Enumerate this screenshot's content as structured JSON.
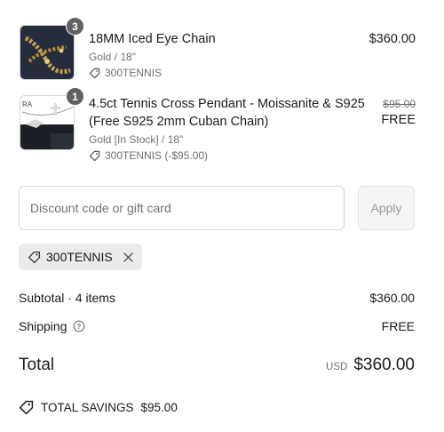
{
  "line_items": [
    {
      "title": "18MM Iced Eye Chain",
      "quantity": "3",
      "variant": "Gold / 18\"",
      "discount_code": "300TENNIS",
      "price": "$360.00",
      "image": "gold-iced-chain-thumbnail"
    },
    {
      "title_line1": "4.5ct Tennis Cross Pendant - Moissanite & S925",
      "title_line2": "(Free S925 2mm Cuban Chain)",
      "quantity": "1",
      "variant": "Gold [In Stock] / 18\"",
      "discount_code": "300TENNIS (-$95.00)",
      "original_price": "$95.00",
      "price": "FREE",
      "image": "cross-pendant-thumbnail"
    }
  ],
  "discount": {
    "placeholder": "Discount code or gift card",
    "apply_label": "Apply",
    "applied_code": "300TENNIS"
  },
  "summary": {
    "subtotal_label": "Subtotal · 4 items",
    "subtotal_value": "$360.00",
    "shipping_label": "Shipping",
    "shipping_value": "FREE",
    "total_label": "Total",
    "currency": "USD",
    "total_value": "$360.00",
    "savings_label": "TOTAL SAVINGS",
    "savings_value": "$95.00"
  },
  "colors": {
    "badge": "#616161",
    "muted_text": "#707070",
    "chip_bg": "#ebebeb",
    "apply_bg": "#f5f5f5"
  }
}
